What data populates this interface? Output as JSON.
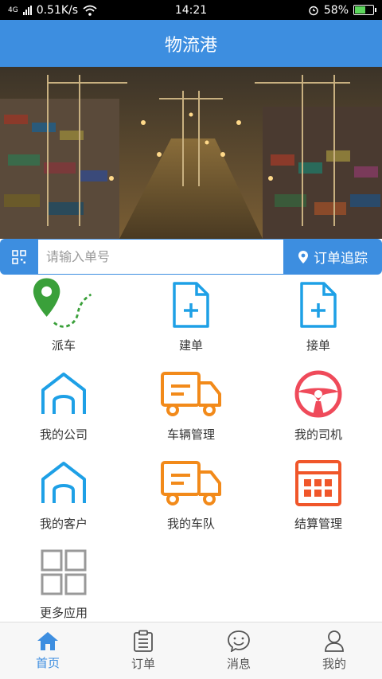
{
  "status_bar": {
    "network": "4G",
    "speed": "0.51K/s",
    "time": "14:21",
    "battery": "58%",
    "battery_level": 0.58
  },
  "header": {
    "title": "物流港"
  },
  "search": {
    "placeholder": "请输入单号",
    "track_label": "订单追踪"
  },
  "grid": [
    {
      "label": "派车",
      "icon": "dispatch-route-icon",
      "color": "#3aa03a"
    },
    {
      "label": "建单",
      "icon": "create-order-icon",
      "color": "#1ea0e6"
    },
    {
      "label": "接单",
      "icon": "accept-order-icon",
      "color": "#1ea0e6"
    },
    {
      "label": "我的公司",
      "icon": "company-house-icon",
      "color": "#1ea0e6"
    },
    {
      "label": "车辆管理",
      "icon": "truck-icon",
      "color": "#f28a1a"
    },
    {
      "label": "我的司机",
      "icon": "steering-wheel-icon",
      "color": "#ef4a5a"
    },
    {
      "label": "我的客户",
      "icon": "customer-house-icon",
      "color": "#1ea0e6"
    },
    {
      "label": "我的车队",
      "icon": "fleet-truck-icon",
      "color": "#f28a1a"
    },
    {
      "label": "结算管理",
      "icon": "calculator-icon",
      "color": "#f0562a"
    },
    {
      "label": "更多应用",
      "icon": "more-apps-icon",
      "color": "#999999"
    }
  ],
  "bottom_nav": [
    {
      "label": "首页",
      "icon": "home-icon",
      "active": true
    },
    {
      "label": "订单",
      "icon": "clipboard-icon",
      "active": false
    },
    {
      "label": "消息",
      "icon": "message-smile-icon",
      "active": false
    },
    {
      "label": "我的",
      "icon": "user-icon",
      "active": false
    }
  ],
  "colors": {
    "primary": "#3d8ee0"
  }
}
